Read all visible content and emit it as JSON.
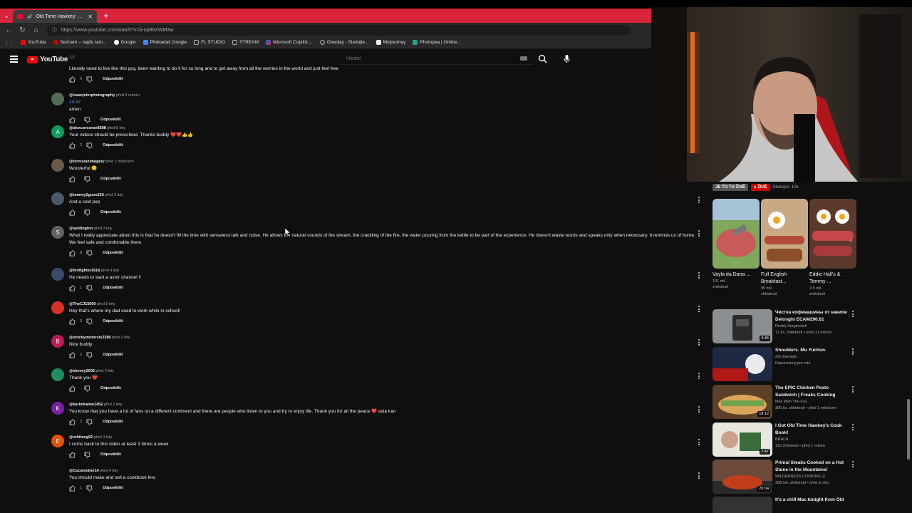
{
  "browser": {
    "tab_title": "Old Time Hawkey: Fritz & Do...",
    "url": "https://www.youtube.com/watch?v=b-op86XWM3w",
    "bookmarks": [
      "YouTube",
      "Seznam – najdu tam...",
      "Google",
      "Překladač Google",
      "FL STUDIO",
      "STREAM",
      "Microsoft Copilot:...",
      "Oneplay - Sledujte...",
      "Midjourney",
      "Photopea | Online..."
    ]
  },
  "youtube": {
    "logo_text": "YouTube",
    "logo_country": "CZ",
    "search_placeholder": "Hledat"
  },
  "comments": [
    {
      "handle": "",
      "time": "",
      "text": "Literally need to live like this guy, been wanting to do it for so long and to get away from all the worries in the world and just feel free",
      "likes": "6",
      "reply": "Odpovědět",
      "avatar_letter": "",
      "avatar_color": "#555"
    },
    {
      "handle": "@isaacjeterphotography",
      "time": "před 9 měsíci",
      "timestamp": "14:47",
      "text": "amen",
      "likes": "",
      "reply": "Odpovědět",
      "avatar_letter": "",
      "avatar_color": "#556b55"
    },
    {
      "handle": "@alexcorcoran8588",
      "time": "před 5 lety",
      "text": "Your videos should be prescribed. Thanks buddy ❤️❤️👍👍",
      "likes": "2",
      "reply": "Odpovědět",
      "avatar_letter": "A",
      "avatar_color": "#0f9d58"
    },
    {
      "handle": "@ternovanimagery",
      "time": "před 1 měsícem",
      "text": "Wonderful 😊",
      "likes": "",
      "reply": "Odpovědět",
      "avatar_letter": "",
      "avatar_color": "#6b5a4a"
    },
    {
      "handle": "@tommy2guns220",
      "time": "před 3 lety",
      "text": "And a cold pop",
      "likes": "",
      "reply": "Odpovědět",
      "avatar_letter": "",
      "avatar_color": "#4a5a6b"
    },
    {
      "handle": "@laddington",
      "time": "před 3 lety",
      "text": "What I really appreciate about this is that he doesn't fill the time with senseless talk and noise. He allows the natural sounds of the stream, the crackling of the fire, the water pouring from the kettle to be part of the experience. He doesn't waste words and speaks only when necessary. It reminds us of home. We feel safe and comfortable there.",
      "likes": "8",
      "reply": "Odpovědět",
      "avatar_letter": "S",
      "avatar_color": "#616161"
    },
    {
      "handle": "@firefighter1616",
      "time": "před 4 lety",
      "text": "He needs to start a asmr channel ‼",
      "likes": "1",
      "reply": "Odpovědět",
      "avatar_letter": "",
      "avatar_color": "#3a4a6b"
    },
    {
      "handle": "@TheCJ15000",
      "time": "před 5 lety",
      "text": "Hey that's where my dad used to work while in school!",
      "likes": "3",
      "reply": "Odpovědět",
      "avatar_letter": "",
      "avatar_color": "#d93025"
    },
    {
      "handle": "@strickymotorsis2396",
      "time": "před 3 lety",
      "text": "Nice buddy",
      "likes": "2",
      "reply": "Odpovědět",
      "avatar_letter": "B",
      "avatar_color": "#c2185b"
    },
    {
      "handle": "@ekeeey2002",
      "time": "před 3 lety",
      "text": "Thank you ❤️",
      "likes": "",
      "reply": "Odpovědět",
      "avatar_letter": "",
      "avatar_color": "#1e8e5e"
    },
    {
      "handle": "@karimkalwe1452",
      "time": "před 2 lety",
      "text": "You know that you have a lot of fans on a different continent and there are people who listen to you and try to enjoy life. Thank you for all the peace ❤️ asia iran",
      "likes": "2",
      "reply": "Odpovědět",
      "avatar_letter": "K",
      "avatar_color": "#7b1fa2"
    },
    {
      "handle": "@orkitang92",
      "time": "před 3 lety",
      "text": "I come back to this video at least 3 times a week",
      "likes": "",
      "reply": "Odpovědět",
      "avatar_letter": "E",
      "avatar_color": "#e65100"
    },
    {
      "handle": "@Cucamober14",
      "time": "před 4 lety",
      "text": "You should make and sell a cookbook lmo",
      "likes": "1",
      "reply": "Odpovědět",
      "avatar_letter": "",
      "avatar_color": "transparent"
    }
  ],
  "sidebar": {
    "shorts_label": "JE TO TU ŽIVĚ",
    "shorts_live": "● ŽIVĚ",
    "shorts_sub": "Sledující: 10k",
    "shorts": [
      {
        "title": "Vayla da Dana ...",
        "views": "131 mil.",
        "meta": "zhlédnutí"
      },
      {
        "title": "Full English Breakfast...",
        "views": "95 mil.",
        "meta": "zhlédnutí"
      },
      {
        "title": "Eddie Hall's & Tommy ...",
        "views": "3,5 mil.",
        "meta": "zhlédnutí"
      }
    ],
    "videos": [
      {
        "title": "Чистка кофемашины от накипи Delonghi ECAM290.61",
        "channel": "Dmitrij Sergeevich",
        "stats": "72 tis. zhlédnutí • před 11 měsíci",
        "duration": "3:46"
      },
      {
        "title": "Shoulders. Mu Yuchun.",
        "channel": "Zijn Kanaals",
        "stats": "Doporučený pro vás",
        "duration": ""
      },
      {
        "title": "The EPIC Chicken Pesto Sandwich | Freaks Cooking",
        "channel": "Max With The Fox",
        "stats": "385 tis. zhlédnutí • před 1 měsícem",
        "duration": "18:12"
      },
      {
        "title": "I Got Old Time Hawkey's Cook Book!",
        "channel": "BRALN",
        "stats": "119 zhlédnutí • před 1 rokem",
        "duration": "2:47"
      },
      {
        "title": "Primal Steaks Cooked on a Hot Stone in the Mountains!",
        "channel": "WILDERNESS COOKING ◎",
        "stats": "308 mil. zhlédnutí • před 3 roky",
        "duration": "20:04"
      },
      {
        "title": "It's a chill Mac tonight from Old",
        "channel": "",
        "stats": "",
        "duration": ""
      }
    ]
  }
}
